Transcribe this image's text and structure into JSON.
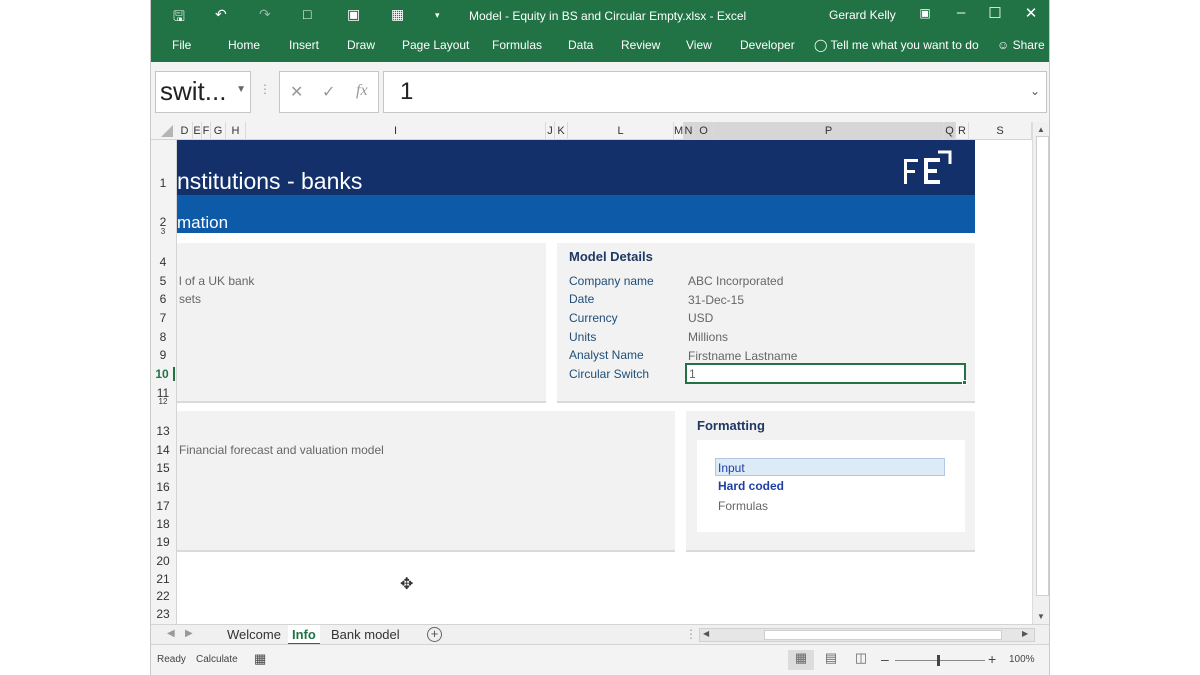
{
  "app": {
    "title": "Model - Equity in BS and Circular Empty.xlsx  -  Excel",
    "user": "Gerard Kelly",
    "ribbon_tabs": [
      "File",
      "Home",
      "Insert",
      "Draw",
      "Page Layout",
      "Formulas",
      "Data",
      "Review",
      "View",
      "Developer"
    ],
    "tell_me": "Tell me what you want to do",
    "share": "Share"
  },
  "formula_bar": {
    "name_box": "swit...",
    "cancel": "✕",
    "enter": "✓",
    "fx": "fx",
    "value": "1"
  },
  "columns": [
    "D",
    "E",
    "F",
    "G",
    "H",
    "I",
    "J",
    "K",
    "L",
    "M",
    "N",
    "O",
    "P",
    "Q",
    "R",
    "S"
  ],
  "rows": [
    "1",
    "2",
    "3",
    "4",
    "5",
    "6",
    "7",
    "8",
    "9",
    "10",
    "11",
    "12",
    "13",
    "14",
    "15",
    "16",
    "17",
    "18",
    "19",
    "20",
    "21",
    "22",
    "23"
  ],
  "sheet": {
    "header_title": "nstitutions - banks",
    "header_subtitle": "mation",
    "left_panel": {
      "line1": "l of a UK bank",
      "line2": "sets"
    },
    "model_details": {
      "heading": "Model Details",
      "labels": [
        "Company name",
        "Date",
        "Currency",
        "Units",
        "Analyst Name",
        "Circular Switch"
      ],
      "values": [
        "ABC Incorporated",
        "31-Dec-15",
        "USD",
        "Millions",
        "Firstname Lastname",
        "1"
      ]
    },
    "description": "Financial forecast and valuation model",
    "formatting": {
      "heading": "Formatting",
      "input": "Input",
      "hard_coded": "Hard coded",
      "formulas": "Formulas"
    }
  },
  "sheet_tabs": [
    "Welcome",
    "Info",
    "Bank model"
  ],
  "active_tab": "Info",
  "status": {
    "ready": "Ready",
    "calculate": "Calculate",
    "zoom": "100%"
  },
  "colors": {
    "excel_green": "#217346",
    "header_dark": "#13306a",
    "header_blue": "#0d5ba8",
    "label_blue": "#1f4e79"
  }
}
